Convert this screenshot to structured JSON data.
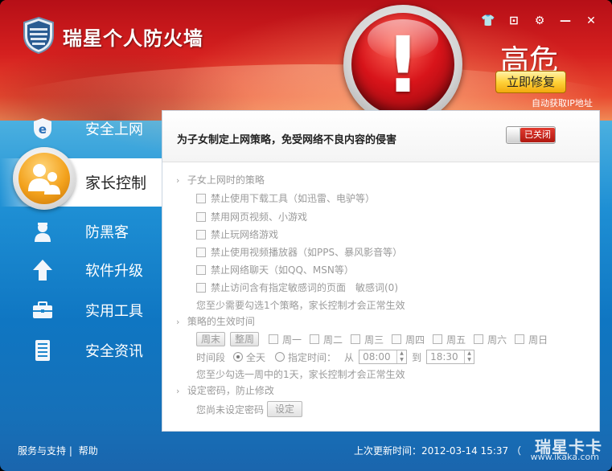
{
  "window": {
    "title": "瑞星个人防火墙",
    "controls": {
      "skin": "👕",
      "menu": "⊡",
      "settings": "⚙",
      "minimize": "—",
      "close": "✕"
    }
  },
  "status": {
    "risk_level": "高危",
    "fix_button": "立即修复",
    "auto_ip": "自动获取IP地址",
    "alarm_symbol": "!"
  },
  "sidebar": {
    "items": [
      {
        "label": "安全上网",
        "icon": "ie-shield-icon"
      },
      {
        "label": "家长控制",
        "icon": "family-icon",
        "active": true
      },
      {
        "label": "防黑客",
        "icon": "hacker-icon"
      },
      {
        "label": "软件升级",
        "icon": "upload-arrow-icon"
      },
      {
        "label": "实用工具",
        "icon": "toolbox-icon"
      },
      {
        "label": "安全资讯",
        "icon": "news-icon"
      }
    ]
  },
  "panel": {
    "title": "为子女制定上网策略，免受网络不良内容的侵害",
    "toggle_state": "已关闭",
    "section1": {
      "heading": "子女上网时的策略",
      "options": [
        "禁止使用下载工具（如迅雷、电驴等）",
        "禁用网页视频、小游戏",
        "禁止玩网络游戏",
        "禁止使用视频播放器（如PPS、暴风影音等）",
        "禁止网络聊天（如QQ、MSN等）",
        "禁止访问含有指定敏感词的页面　敏感词(0)"
      ],
      "note": "您至少需要勾选1个策略，家长控制才会正常生效"
    },
    "section2": {
      "heading": "策略的生效时间",
      "weekend_button": "周末",
      "all_week_button": "整周",
      "days": [
        "周一",
        "周二",
        "周三",
        "周四",
        "周五",
        "周六",
        "周日"
      ],
      "period_label": "时间段",
      "all_day": "全天",
      "specific_time": "指定时间：",
      "from_label": "从",
      "from_value": "08:00",
      "to_label": "到",
      "to_value": "18:30",
      "note": "您至少勾选一周中的1天，家长控制才会正常生效"
    },
    "section3": {
      "heading": "设定密码，防止修改",
      "note": "您尚未设定密码",
      "set_button": "设定"
    }
  },
  "footer": {
    "support": "服务与支持",
    "separator": "|",
    "help": "帮助",
    "last_update": "上次更新时间：2012-03-14 15:37 （",
    "watermark_top": "瑞星卡卡",
    "watermark_bottom": "www.ikaka.com"
  }
}
